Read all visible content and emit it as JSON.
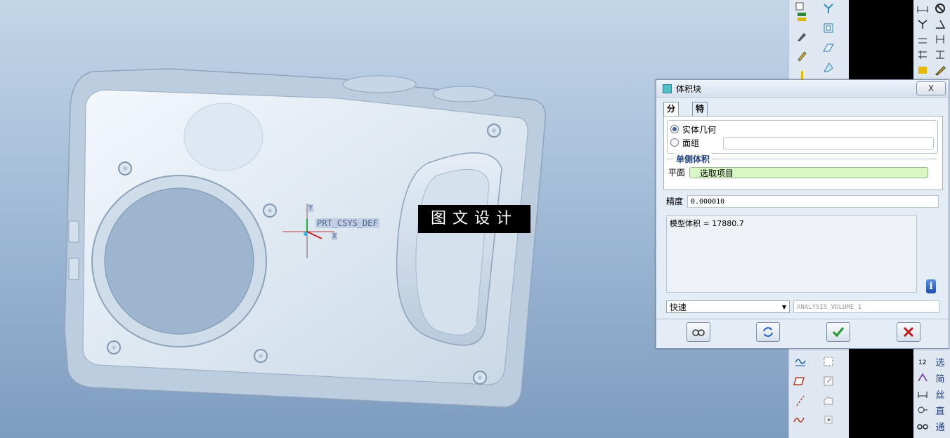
{
  "viewport": {
    "csys_label": "PRT_CSYS_DEF",
    "axis_y": "Y",
    "axis_x": "X",
    "watermark": "图文设计"
  },
  "toolbar_right": {
    "labels": [
      "选",
      "简",
      "丝",
      "直",
      "通"
    ]
  },
  "dialog": {
    "title": "体积块",
    "close_label": "X",
    "tabs": [
      "分析",
      "特征"
    ],
    "radio_solid": "实体几何",
    "radio_quilt": "面组",
    "section_title": "单侧体积",
    "plane_label": "平面",
    "plane_value": "选取项目",
    "precision_label": "精度",
    "precision_value": "0.000010",
    "result_text": "模型体积 = 17880.7",
    "mode_value": "快速",
    "analysis_name": "ANALYSIS_VOLUME_1"
  },
  "colors": {
    "accent": "#3b5fa8",
    "ok_green": "#1e9a2a",
    "cancel_red": "#c21a1a",
    "selection_field": "#d9f6c5"
  }
}
